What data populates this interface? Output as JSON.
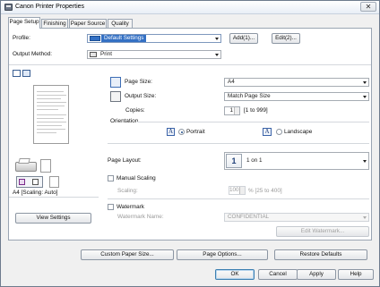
{
  "window": {
    "title": "Canon Printer Properties",
    "close_glyph": "✕"
  },
  "tabs": [
    {
      "label": "Page Setup",
      "active": true
    },
    {
      "label": "Finishing",
      "active": false
    },
    {
      "label": "Paper Source",
      "active": false
    },
    {
      "label": "Quality",
      "active": false
    }
  ],
  "profile": {
    "label": "Profile:",
    "value": "Default Settings",
    "add_label": "Add(1)...",
    "edit_label": "Edit(2)..."
  },
  "output_method": {
    "label": "Output Method:",
    "value": "Print"
  },
  "preview": {
    "caption": "A4 [Scaling: Auto]",
    "view_settings_label": "View Settings"
  },
  "page_size": {
    "label": "Page Size:",
    "value": "A4"
  },
  "output_size": {
    "label": "Output Size:",
    "value": "Match Page Size"
  },
  "copies": {
    "label": "Copies:",
    "value": "1",
    "range": "[1 to 999]"
  },
  "orientation": {
    "label": "Orientation",
    "portrait_label": "Portrait",
    "landscape_label": "Landscape",
    "selected": "Portrait",
    "icon_glyph": "A"
  },
  "page_layout": {
    "label": "Page Layout:",
    "value": "1 on 1",
    "icon_glyph": "1"
  },
  "manual_scaling": {
    "label": "Manual Scaling",
    "checked": false,
    "scaling_label": "Scaling:",
    "scaling_value": "100",
    "range": "% [25 to 400]"
  },
  "watermark": {
    "label": "Watermark",
    "checked": false,
    "name_label": "Watermark Name:",
    "name_value": "CONFIDENTIAL",
    "edit_label": "Edit Watermark..."
  },
  "bottom_buttons": {
    "custom_paper_size": "Custom Paper Size...",
    "page_options": "Page Options...",
    "restore_defaults": "Restore Defaults"
  },
  "dialog_buttons": {
    "ok": "OK",
    "cancel": "Cancel",
    "apply": "Apply",
    "help": "Help"
  },
  "colors": {
    "accent_blue": "#3d6db5",
    "profile_highlight": "#3370c4"
  }
}
